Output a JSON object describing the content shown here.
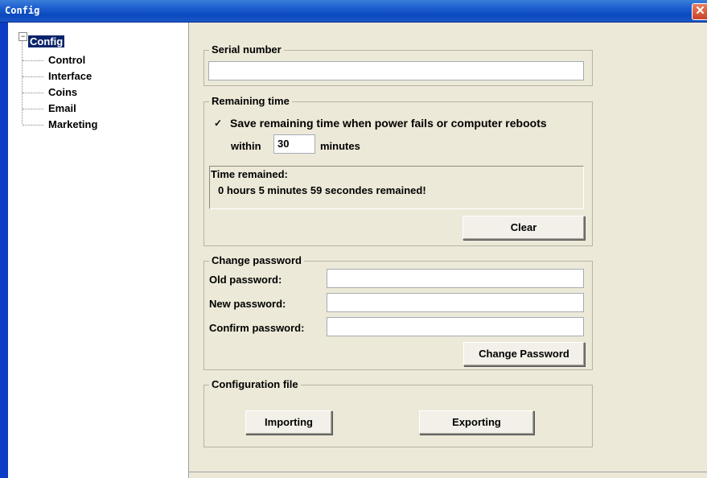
{
  "window": {
    "title": "Config",
    "close_symbol": "✕"
  },
  "tree": {
    "expander_symbol": "−",
    "root": "Config",
    "children": [
      "Control",
      "Interface",
      "Coins",
      "Email",
      "Marketing"
    ]
  },
  "serial": {
    "legend": "Serial number",
    "value": ""
  },
  "remaining": {
    "legend": "Remaining time",
    "checkbox_checked": true,
    "checkbox_mark": "✓",
    "save_label": "Save remaining time when power fails or computer reboots",
    "within_label": "within",
    "minutes_value": "30",
    "minutes_label": "minutes",
    "time_title": "Time remained:",
    "time_value": "0 hours 5 minutes 59 secondes remained!",
    "clear_button": "Clear"
  },
  "password": {
    "legend": "Change password",
    "old_label": "Old password:",
    "new_label": "New password:",
    "confirm_label": "Confirm password:",
    "change_button": "Change Password"
  },
  "config_file": {
    "legend": "Configuration file",
    "import_button": "Importing",
    "export_button": "Exporting"
  }
}
